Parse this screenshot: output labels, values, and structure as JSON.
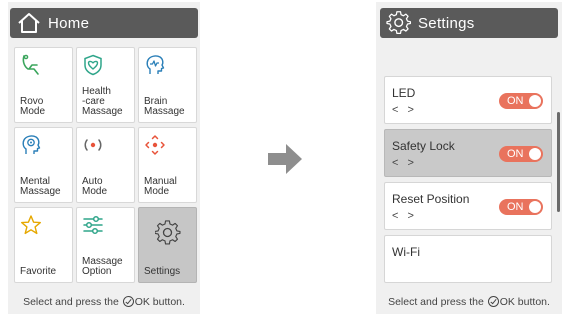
{
  "left_panel": {
    "title": "Home",
    "tiles": [
      {
        "label": "Rovo\nMode",
        "icon": "rovo-chair-icon"
      },
      {
        "label": "Health\n-care\nMassage",
        "icon": "heart-shield-icon"
      },
      {
        "label": "Brain\nMassage",
        "icon": "brain-head-icon"
      },
      {
        "label": "Mental\nMassage",
        "icon": "mental-head-icon"
      },
      {
        "label": "Auto\nMode",
        "icon": "auto-dial-icon"
      },
      {
        "label": "Manual\nMode",
        "icon": "manual-dpad-icon"
      },
      {
        "label": "Favorite",
        "icon": "star-icon"
      },
      {
        "label": "Massage\nOption",
        "icon": "sliders-icon"
      },
      {
        "label": "Settings",
        "icon": "gear-icon",
        "selected": true
      }
    ],
    "footer": {
      "before": "Select and press the",
      "after": "OK button."
    }
  },
  "right_panel": {
    "title": "Settings",
    "rows": [
      {
        "label": "LED",
        "nav": "< >",
        "toggle": "ON"
      },
      {
        "label": "Safety Lock",
        "nav": "< >",
        "toggle": "ON",
        "selected": true
      },
      {
        "label": "Reset Position",
        "nav": "< >",
        "toggle": "ON"
      },
      {
        "label": "Wi-Fi"
      }
    ],
    "footer": {
      "before": "Select and press the",
      "after": "OK button."
    }
  },
  "colors": {
    "accent_icon": "#2fa58a",
    "icon_green": "#3aa55c",
    "icon_blue": "#2a7fb8",
    "icon_orange": "#e8533a",
    "icon_yellow": "#e6a800",
    "toggle_on": "#e9735d",
    "title_bar": "#5a5a5a"
  }
}
